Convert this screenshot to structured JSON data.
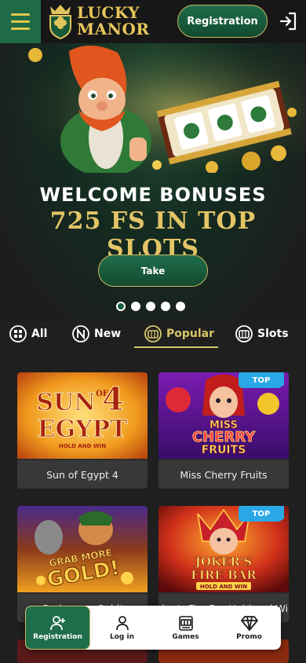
{
  "header": {
    "logo_line1": "LUCKY",
    "logo_line2": "MANOR",
    "registration_label": "Registration",
    "login_icon": "login-icon",
    "menu_icon": "hamburger-menu-icon"
  },
  "banner": {
    "title": "WELCOME BONUSES",
    "subtitle": "725 FS IN TOP SLOTS",
    "cta_label": "Take",
    "slides_total": 5,
    "slide_active": 1
  },
  "tabs": [
    {
      "label": "All",
      "icon": "grid-icon",
      "active": false
    },
    {
      "label": "New",
      "icon": "new-badge-icon",
      "active": false
    },
    {
      "label": "Popular",
      "icon": "slot-machine-icon",
      "active": true
    },
    {
      "label": "Slots",
      "icon": "slots-icon",
      "active": false
    }
  ],
  "games": [
    {
      "name": "Sun of Egypt 4",
      "badge": ""
    },
    {
      "name": "Miss Cherry Fruits",
      "badge": "TOP"
    },
    {
      "name": "Grab more Gold!",
      "badge": ""
    },
    {
      "name": "Joker's Fire Bar Hold and Win",
      "badge": "TOP"
    }
  ],
  "game_art": {
    "sun_of_egypt_line1": "SUN",
    "sun_of_egypt_of": "OF",
    "sun_of_egypt_num": "4",
    "sun_of_egypt_line2": "EGYPT",
    "sun_of_egypt_tag": "HOLD AND WIN",
    "miss_cherry_line1": "MISS",
    "miss_cherry_line2": "CHERRY",
    "miss_cherry_line3": "FRUITS",
    "grab_line1": "GRAB MORE",
    "grab_line2": "GOLD!",
    "joker_line1": "JOKER'S",
    "joker_line2": "FIRE BAR",
    "joker_tag": "HOLD AND WIN"
  },
  "bottom_nav": [
    {
      "label": "Registration",
      "icon": "add-user-icon",
      "active": true
    },
    {
      "label": "Log in",
      "icon": "user-icon",
      "active": false
    },
    {
      "label": "Games",
      "icon": "slot-machine-icon",
      "active": false
    },
    {
      "label": "Promo",
      "icon": "diamond-icon",
      "active": false
    }
  ],
  "colors": {
    "brand_green": "#1f6e4b",
    "gold": "#d8c668",
    "background": "#1f1f1f"
  }
}
